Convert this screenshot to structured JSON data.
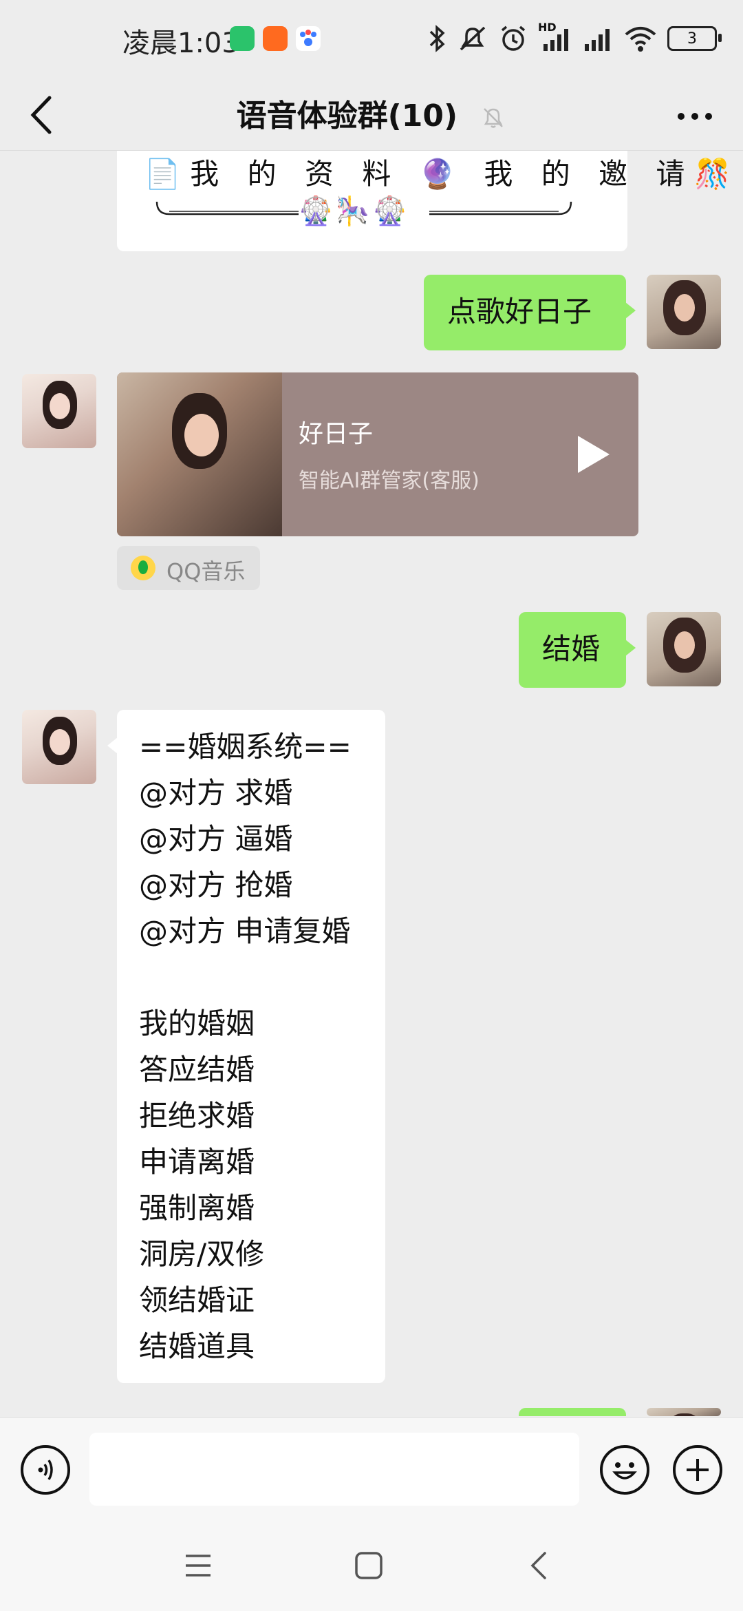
{
  "status_bar": {
    "time": "凌晨1:03",
    "battery": "3",
    "signal_hd": "HD"
  },
  "header": {
    "title": "语音体验群(10)"
  },
  "messages": {
    "card_line": "📄我 的 资 料 🔮 我 的 邀 请🎊",
    "card_deco": "🎡🎠🎡",
    "msg1": "点歌好日子",
    "music": {
      "song": "好日子",
      "subtitle": "智能AI群管家(客服)",
      "source": "QQ音乐"
    },
    "msg2": "结婚",
    "marriage_menu": [
      "==婚姻系统==",
      "@对方 求婚",
      "@对方 逼婚",
      "@对方 抢婚",
      "@对方 申请复婚",
      "",
      "我的婚姻",
      "答应结婚",
      "拒绝求婚",
      "申请离婚",
      "强制离婚",
      "洞房/双修",
      "领结婚证",
      "结婚道具"
    ]
  },
  "input": {
    "placeholder": ""
  },
  "colors": {
    "sent_bubble": "#95EC69",
    "received_bubble": "#FFFFFF",
    "background": "#EDEDED",
    "music_card": "#9C8784"
  }
}
